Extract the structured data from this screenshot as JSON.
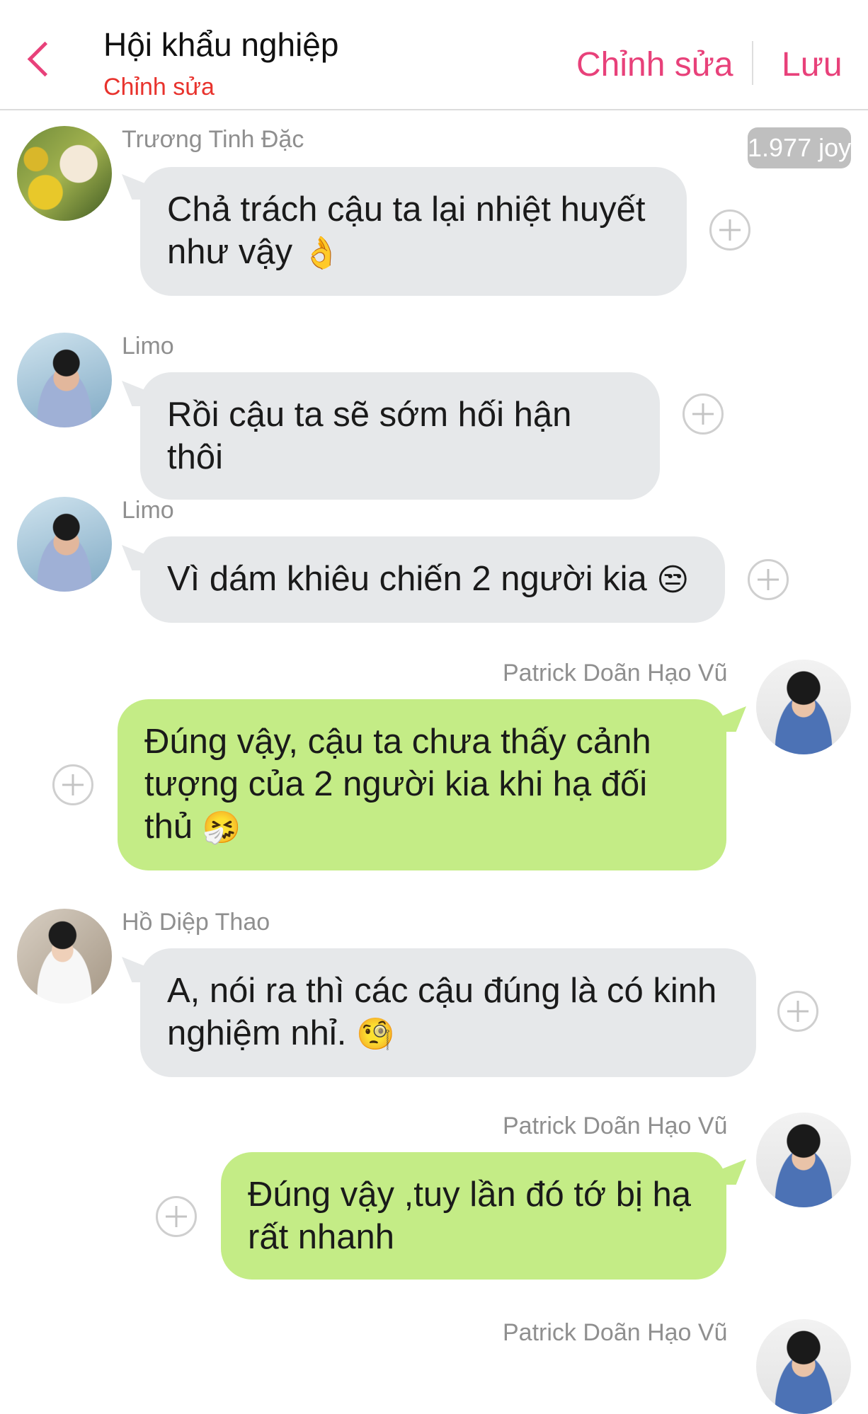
{
  "header": {
    "title": "Hội khẩu nghiệp",
    "subtitle": "Chỉnh sửa",
    "edit_label": "Chỉnh sửa",
    "save_label": "Lưu",
    "accent_color": "#e8417a"
  },
  "badge": {
    "joy": "1.977 joy"
  },
  "messages": [
    {
      "sender": "Trương Tinh Đặc",
      "side": "left",
      "text": "Chả trách cậu ta lại nhiệt huyết như vậy",
      "emoji": "👌"
    },
    {
      "sender": "Limo",
      "side": "left",
      "text": "Rồi cậu ta sẽ sớm hối hận thôi",
      "emoji": ""
    },
    {
      "sender": "Limo",
      "side": "left",
      "text": "Vì dám khiêu chiến 2 người kia",
      "emoji": "😒"
    },
    {
      "sender": "Patrick Doãn Hạo Vũ",
      "side": "right",
      "text": "Đúng vậy, cậu ta chưa thấy cảnh tượng của 2 người kia khi hạ đối thủ",
      "emoji": "🤧"
    },
    {
      "sender": "Hồ Diệp Thao",
      "side": "left",
      "text": "A, nói ra thì các cậu đúng là có kinh nghiệm nhỉ.",
      "emoji": "🧐"
    },
    {
      "sender": "Patrick Doãn Hạo Vũ",
      "side": "right",
      "text": "Đúng vậy ,tuy lần đó tớ bị hạ rất nhanh",
      "emoji": ""
    },
    {
      "sender": "Patrick Doãn Hạo Vũ",
      "side": "right",
      "text": "",
      "emoji": ""
    }
  ],
  "colors": {
    "left_bubble": "#e6e8ea",
    "right_bubble": "#c4ec86"
  }
}
